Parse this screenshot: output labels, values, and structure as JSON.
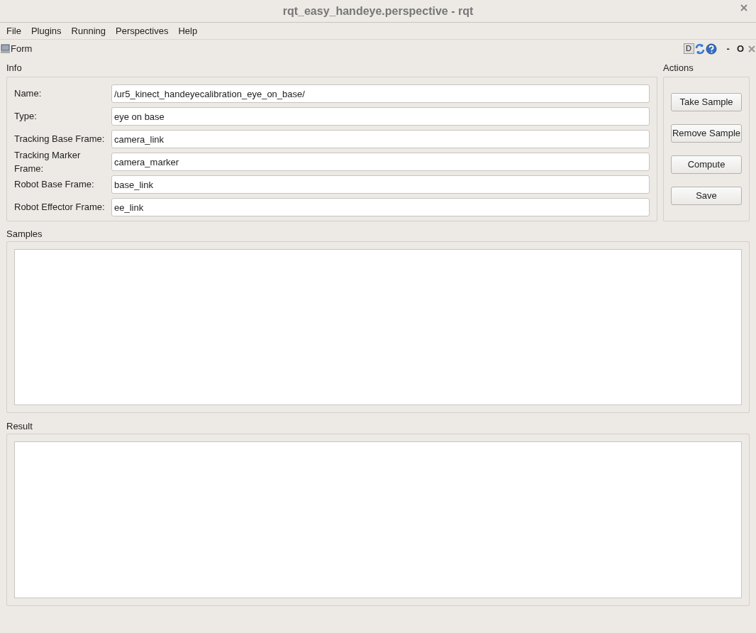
{
  "window": {
    "title": "rqt_easy_handeye.perspective - rqt"
  },
  "menu": [
    "File",
    "Plugins",
    "Running",
    "Perspectives",
    "Help"
  ],
  "plugin": {
    "title": "Form",
    "controls": [
      "D",
      "-",
      "O"
    ]
  },
  "info": {
    "title": "Info",
    "fields": [
      {
        "label": "Name:",
        "value": "/ur5_kinect_handeyecalibration_eye_on_base/"
      },
      {
        "label": "Type:",
        "value": "eye on base"
      },
      {
        "label": "Tracking Base Frame:",
        "value": "camera_link"
      },
      {
        "label": "Tracking Marker Frame:",
        "value": "camera_marker"
      },
      {
        "label": "Robot Base Frame:",
        "value": "base_link"
      },
      {
        "label": "Robot Effector Frame:",
        "value": "ee_link"
      }
    ]
  },
  "actions": {
    "title": "Actions",
    "buttons": [
      "Take Sample",
      "Remove Sample",
      "Compute",
      "Save"
    ]
  },
  "samples": {
    "title": "Samples"
  },
  "result": {
    "title": "Result"
  }
}
